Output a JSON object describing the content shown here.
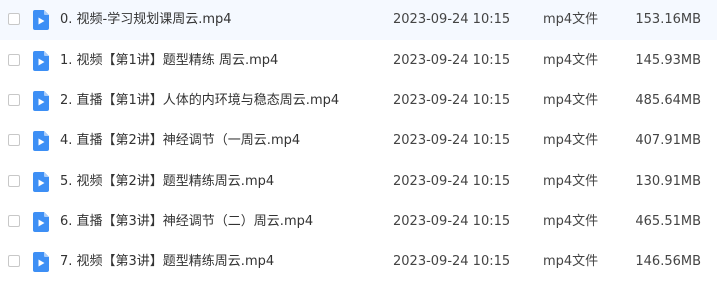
{
  "colors": {
    "icon_blue": "#3d8ff5",
    "icon_fold": "#a9cdfa"
  },
  "file_icon": "video-file-icon",
  "files": [
    {
      "name": "0. 视频-学习规划课周云.mp4",
      "date": "2023-09-24 10:15",
      "type": "mp4文件",
      "size": "153.16MB"
    },
    {
      "name": "1. 视频【第1讲】题型精练 周云.mp4",
      "date": "2023-09-24 10:15",
      "type": "mp4文件",
      "size": "145.93MB"
    },
    {
      "name": "2. 直播【第1讲】人体的内环境与稳态周云.mp4",
      "date": "2023-09-24 10:15",
      "type": "mp4文件",
      "size": "485.64MB"
    },
    {
      "name": "4. 直播【第2讲】神经调节（一周云.mp4",
      "date": "2023-09-24 10:15",
      "type": "mp4文件",
      "size": "407.91MB"
    },
    {
      "name": "5. 视频【第2讲】题型精练周云.mp4",
      "date": "2023-09-24 10:15",
      "type": "mp4文件",
      "size": "130.91MB"
    },
    {
      "name": "6. 直播【第3讲】神经调节（二）周云.mp4",
      "date": "2023-09-24 10:15",
      "type": "mp4文件",
      "size": "465.51MB"
    },
    {
      "name": "7. 视频【第3讲】题型精练周云.mp4",
      "date": "2023-09-24 10:15",
      "type": "mp4文件",
      "size": "146.56MB"
    }
  ]
}
